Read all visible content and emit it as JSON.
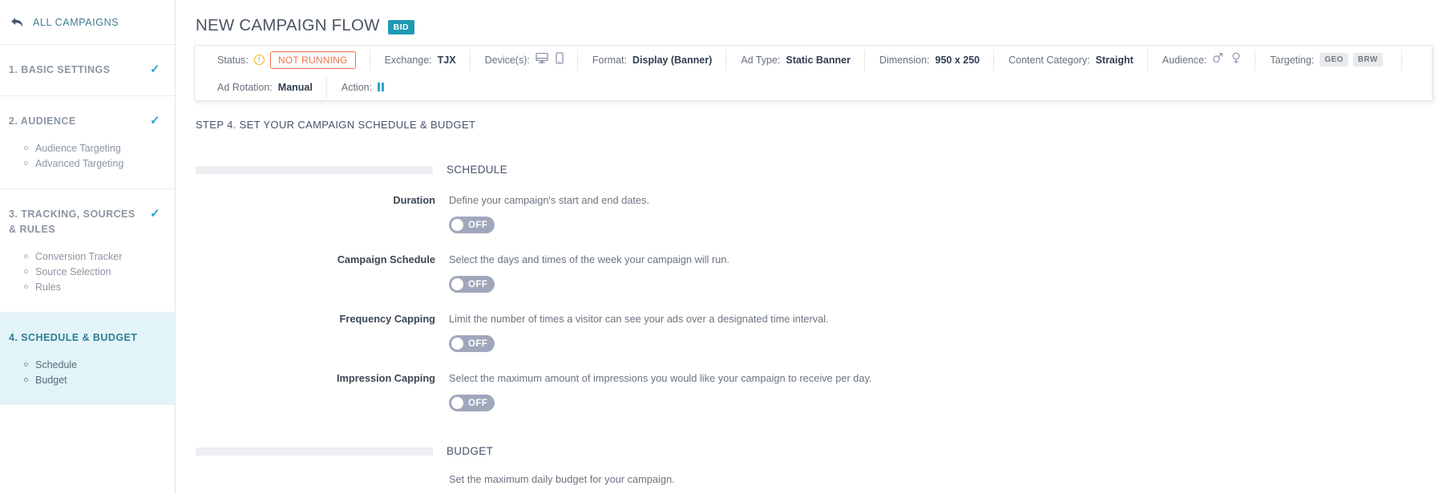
{
  "sidebar": {
    "back": {
      "label": "ALL CAMPAIGNS",
      "icon": "back-arrow-icon"
    },
    "sections": [
      {
        "number_label": "1. BASIC SETTINGS",
        "checked": "✓",
        "items": []
      },
      {
        "number_label": "2. AUDIENCE",
        "checked": "✓",
        "items": [
          "Audience Targeting",
          "Advanced Targeting"
        ]
      },
      {
        "number_label": "3. TRACKING, SOURCES & RULES",
        "checked": "✓",
        "items": [
          "Conversion Tracker",
          "Source Selection",
          "Rules"
        ]
      },
      {
        "number_label": "4. SCHEDULE & BUDGET",
        "checked": "",
        "items": [
          "Schedule",
          "Budget"
        ]
      }
    ]
  },
  "header": {
    "title": "NEW CAMPAIGN FLOW",
    "badge": "BID",
    "badge_color": "#1f9ab5"
  },
  "status_panel": {
    "row1": [
      {
        "label": "Status:",
        "type": "status",
        "icon": "warning-circle-icon",
        "value": "NOT RUNNING",
        "value_color": "#f1704a"
      },
      {
        "label": "Exchange:",
        "type": "text",
        "value": "TJX"
      },
      {
        "label": "Device(s):",
        "type": "icons",
        "icons": [
          "desktop-icon",
          "mobile-icon"
        ]
      },
      {
        "label": "Format:",
        "type": "text",
        "value": "Display (Banner)"
      },
      {
        "label": "Ad Type:",
        "type": "text",
        "value": "Static Banner"
      },
      {
        "label": "Dimension:",
        "type": "text",
        "value": "950 x 250"
      },
      {
        "label": "Content Category:",
        "type": "text",
        "value": "Straight"
      },
      {
        "label": "Audience:",
        "type": "icons",
        "icons": [
          "male-icon",
          "female-icon"
        ]
      },
      {
        "label": "Targeting:",
        "type": "tags",
        "tags": [
          "GEO",
          "BRW"
        ]
      }
    ],
    "row2": [
      {
        "label": "Ad Rotation:",
        "type": "text",
        "value": "Manual"
      },
      {
        "label": "Action:",
        "type": "pause",
        "icon": "pause-icon"
      }
    ]
  },
  "step": {
    "title": "STEP 4. SET YOUR CAMPAIGN SCHEDULE & BUDGET"
  },
  "schedule": {
    "section_name": "SCHEDULE",
    "rows": [
      {
        "label": "Duration",
        "desc": "Define your campaign's start and end dates.",
        "toggle": "OFF"
      },
      {
        "label": "Campaign Schedule",
        "desc": "Select the days and times of the week your campaign will run.",
        "toggle": "OFF"
      },
      {
        "label": "Frequency Capping",
        "desc": "Limit the number of times a visitor can see your ads over a designated time interval.",
        "toggle": "OFF"
      },
      {
        "label": "Impression Capping",
        "desc": "Select the maximum amount of impressions you would like your campaign to receive per day.",
        "toggle": "OFF"
      }
    ]
  },
  "budget": {
    "section_name": "BUDGET",
    "desc": "Set the maximum daily budget for your campaign."
  }
}
